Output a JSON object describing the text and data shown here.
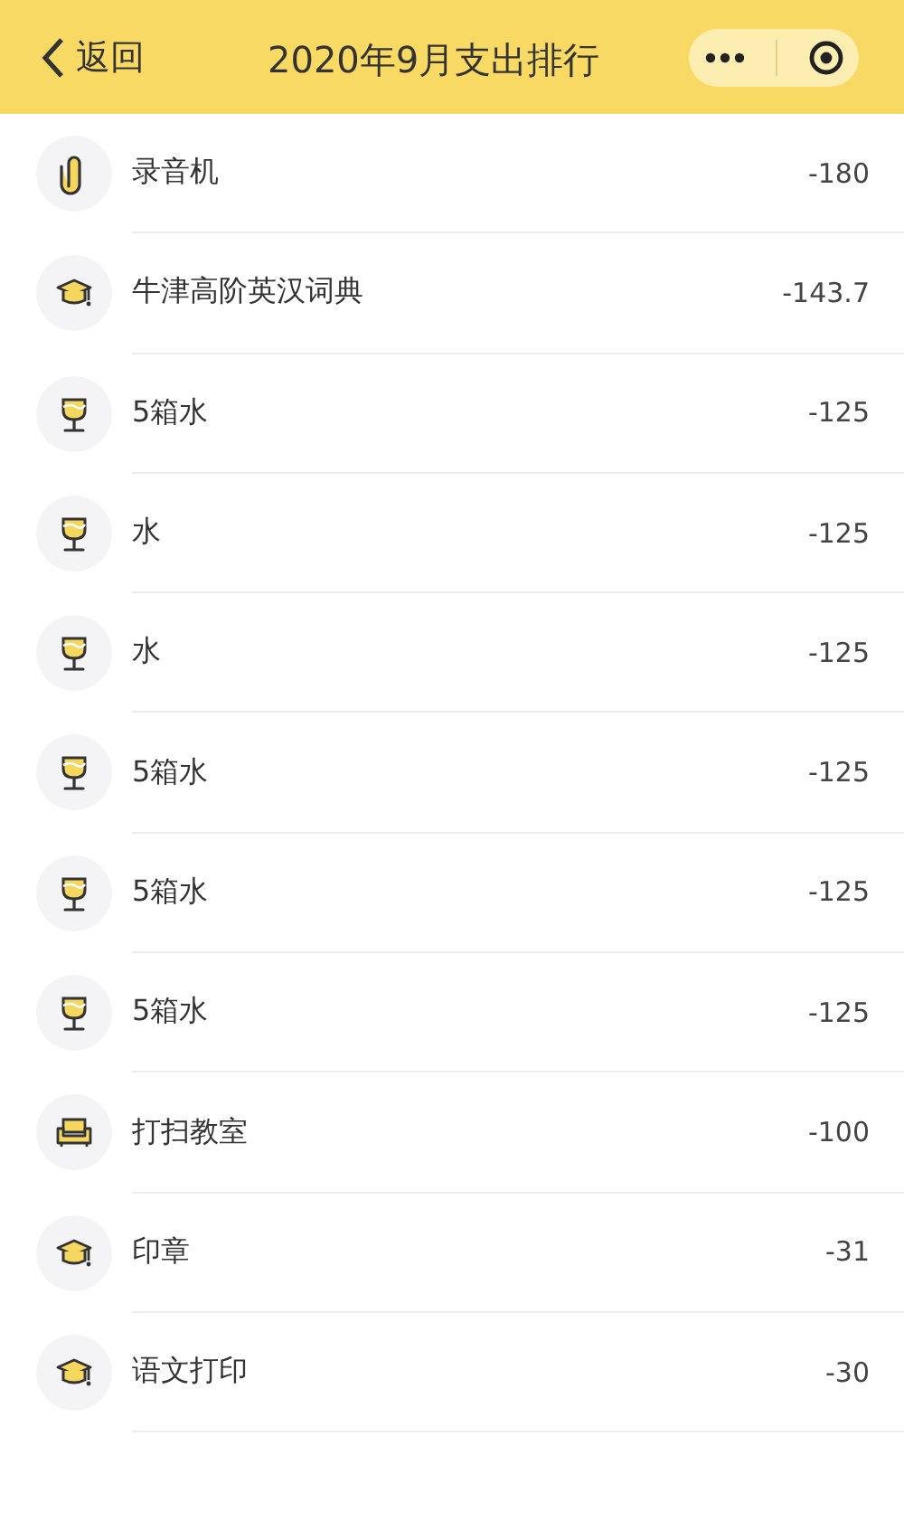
{
  "nav": {
    "back_label": "返回",
    "title": "2020年9月支出排行"
  },
  "items": [
    {
      "kind": "clip",
      "name": "录音机",
      "amount": "-180"
    },
    {
      "kind": "cap",
      "name": "牛津高阶英汉词典",
      "amount": "-143.7"
    },
    {
      "kind": "cup",
      "name": "5箱水",
      "amount": "-125"
    },
    {
      "kind": "cup",
      "name": "水",
      "amount": "-125"
    },
    {
      "kind": "cup",
      "name": "水",
      "amount": "-125"
    },
    {
      "kind": "cup",
      "name": "5箱水",
      "amount": "-125"
    },
    {
      "kind": "cup",
      "name": "5箱水",
      "amount": "-125"
    },
    {
      "kind": "cup",
      "name": "5箱水",
      "amount": "-125"
    },
    {
      "kind": "sofa",
      "name": "打扫教室",
      "amount": "-100"
    },
    {
      "kind": "cap",
      "name": "印章",
      "amount": "-31"
    },
    {
      "kind": "cap",
      "name": "语文打印",
      "amount": "-30"
    }
  ]
}
